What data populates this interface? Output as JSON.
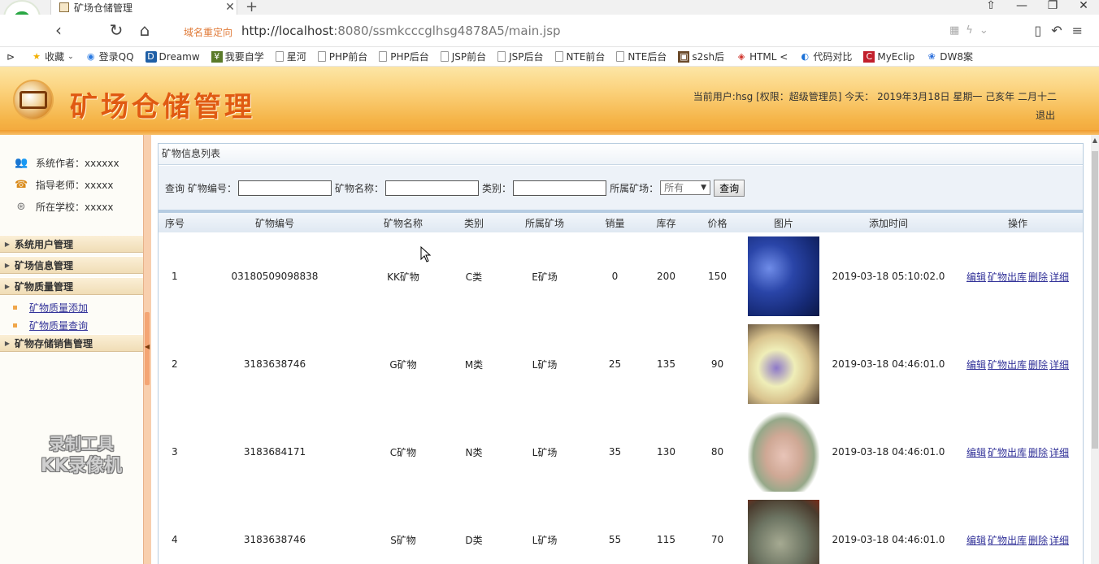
{
  "browser": {
    "tab_title": "矿场仓储管理",
    "address_note": "域名重定向",
    "url_host": "http://localhost",
    "url_rest": ":8080/ssmkcccglhsg4878A5/main.jsp",
    "bookmarks": [
      {
        "label": "收藏",
        "icon": "star-icon"
      },
      {
        "label": "登录QQ",
        "icon": "qq-icon"
      },
      {
        "label": "Dreamw",
        "icon": "dreamweaver-icon"
      },
      {
        "label": "我要自学",
        "icon": "learn-icon"
      },
      {
        "label": "星河",
        "icon": "page-icon"
      },
      {
        "label": "PHP前台",
        "icon": "page-icon"
      },
      {
        "label": "PHP后台",
        "icon": "page-icon"
      },
      {
        "label": "JSP前台",
        "icon": "page-icon"
      },
      {
        "label": "JSP后台",
        "icon": "page-icon"
      },
      {
        "label": "NTE前台",
        "icon": "page-icon"
      },
      {
        "label": "NTE后台",
        "icon": "page-icon"
      },
      {
        "label": "s2sh后",
        "icon": "image-icon"
      },
      {
        "label": "HTML <",
        "icon": "html5-icon"
      },
      {
        "label": "代码对比",
        "icon": "compare-icon"
      },
      {
        "label": "MyEclip",
        "icon": "myeclipse-icon"
      },
      {
        "label": "DW8案",
        "icon": "paw-icon"
      }
    ]
  },
  "header": {
    "title": "矿场仓储管理",
    "user_info": "当前用户:hsg [权限：超级管理员] 今天： 2019年3月18日 星期一 己亥年 二月十二",
    "logout": "退出"
  },
  "sidebar": {
    "info": [
      {
        "label": "系统作者：xxxxxx",
        "icon": "users-icon"
      },
      {
        "label": "指导老师：xxxxx",
        "icon": "teacher-icon"
      },
      {
        "label": "所在学校：xxxxx",
        "icon": "school-icon"
      }
    ],
    "groups": [
      {
        "label": "系统用户管理"
      },
      {
        "label": "矿场信息管理"
      },
      {
        "label": "矿物质量管理"
      },
      {
        "label": "矿物存储销售管理"
      }
    ],
    "sub_items": [
      {
        "label": "矿物质量添加"
      },
      {
        "label": "矿物质量查询"
      }
    ]
  },
  "watermark": {
    "line1": "录制工具",
    "line2": "KK录像机"
  },
  "main": {
    "panel_title": "矿物信息列表",
    "search": {
      "prefix": "查询",
      "field1_label": "矿物编号：",
      "field2_label": "矿物名称：",
      "field3_label": "类别：",
      "field4_label": "所属矿场：",
      "select_value": "所有",
      "button": "查询"
    },
    "columns": [
      "序号",
      "矿物编号",
      "矿物名称",
      "类别",
      "所属矿场",
      "销量",
      "库存",
      "价格",
      "图片",
      "添加时间",
      "操作"
    ],
    "rows": [
      {
        "no": "1",
        "code": "03180509098838",
        "name": "KK矿物",
        "type": "C类",
        "mine": "E矿场",
        "sales": "0",
        "stock": "200",
        "price": "150",
        "time": "2019-03-18 05:10:02.0"
      },
      {
        "no": "2",
        "code": "3183638746",
        "name": "G矿物",
        "type": "M类",
        "mine": "L矿场",
        "sales": "25",
        "stock": "135",
        "price": "90",
        "time": "2019-03-18 04:46:01.0"
      },
      {
        "no": "3",
        "code": "3183684171",
        "name": "C矿物",
        "type": "N类",
        "mine": "L矿场",
        "sales": "35",
        "stock": "130",
        "price": "80",
        "time": "2019-03-18 04:46:01.0"
      },
      {
        "no": "4",
        "code": "3183638746",
        "name": "S矿物",
        "type": "D类",
        "mine": "L矿场",
        "sales": "55",
        "stock": "115",
        "price": "70",
        "time": "2019-03-18 04:46:01.0"
      }
    ],
    "actions": {
      "edit": "编辑",
      "out": "矿物出库",
      "delete": "删除",
      "detail": "详细"
    }
  }
}
